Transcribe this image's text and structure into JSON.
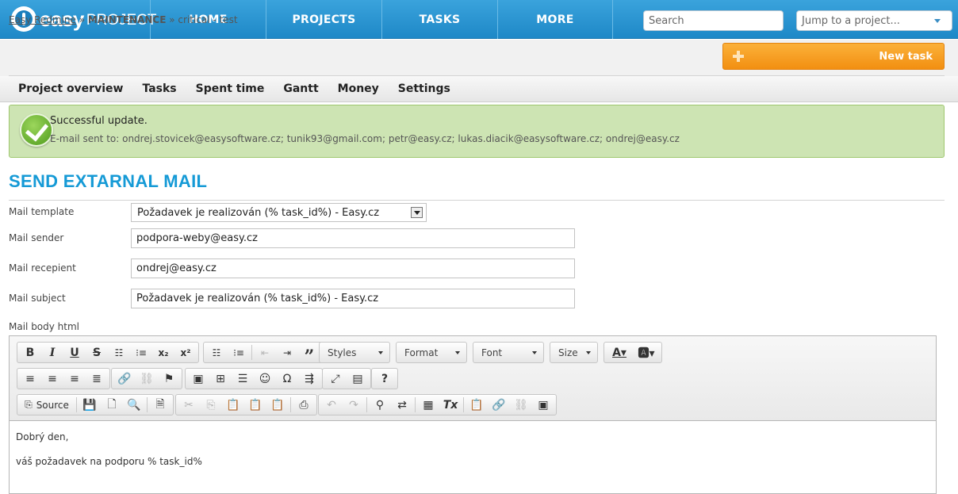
{
  "app": {
    "logo_easy": "easy",
    "logo_project": "PROJECT",
    "brand_color": "#1e88c7"
  },
  "nav": {
    "items": [
      "HOME",
      "PROJECTS",
      "TASKS",
      "MORE"
    ]
  },
  "search": {
    "placeholder": "Search"
  },
  "jump": {
    "placeholder": "Jump to a project..."
  },
  "breadcrumb": {
    "root": "Easy Redmine",
    "sep1": "»",
    "project": "MAINTENANCE",
    "sep2": "»",
    "task": "critical - test"
  },
  "new_task": {
    "label": "New task",
    "color": "#f28f11"
  },
  "project_menu": {
    "items": [
      "Project overview",
      "Tasks",
      "Spent time",
      "Gantt",
      "Money",
      "Settings"
    ]
  },
  "flash": {
    "title": "Successful update.",
    "text": "E-mail sent to: ondrej.stovicek@easysoftware.cz; tunik93@gmail.com; petr@easy.cz; lukas.diacik@easysoftware.cz; ondrej@easy.cz"
  },
  "page_title": "SEND EXTARNAL MAIL",
  "form": {
    "template_label": "Mail template",
    "template_value": "Požadavek je realizován (% task_id%) - Easy.cz",
    "sender_label": "Mail sender",
    "sender_value": "podpora-weby@easy.cz",
    "recipient_label": "Mail recepient",
    "recipient_value": "ondrej@easy.cz",
    "subject_label": "Mail subject",
    "subject_value": "Požadavek je realizován (% task_id%) - Easy.cz",
    "body_label": "Mail body html"
  },
  "editor": {
    "styles": "Styles",
    "format": "Format",
    "font": "Font",
    "size": "Size",
    "source": "Source",
    "body_lines": [
      "Dobrý den,",
      "váš požadavek na podporu % task_id%"
    ]
  }
}
